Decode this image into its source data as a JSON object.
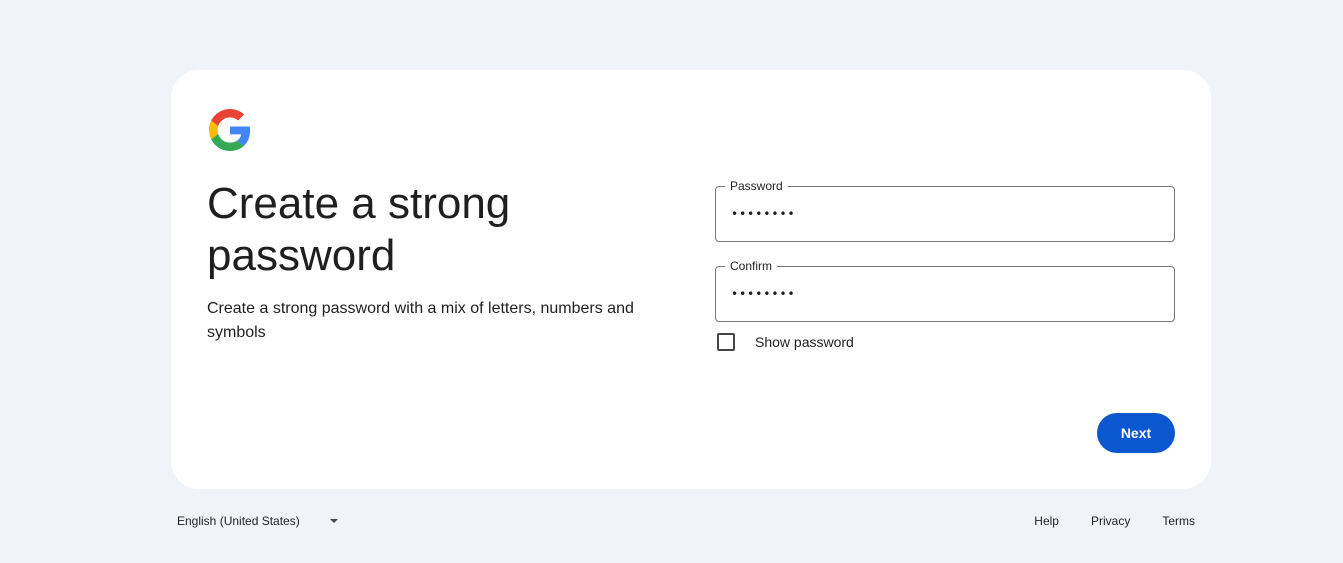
{
  "card": {
    "title": "Create a strong password",
    "subtitle": "Create a strong password with a mix of letters, numbers and symbols"
  },
  "logo": {
    "icon": "google-g-logo-icon",
    "colors": {
      "blue": "#4285F4",
      "red": "#EA4335",
      "yellow": "#FBBC05",
      "green": "#34A853"
    }
  },
  "password_field": {
    "label": "Password",
    "value": "••••••••"
  },
  "confirm_field": {
    "label": "Confirm",
    "value": "••••••••"
  },
  "show_password": {
    "label": "Show password",
    "checked": false
  },
  "next_button": {
    "label": "Next",
    "color": "#0b57d0"
  },
  "footer": {
    "language": "English (United States)",
    "links": [
      "Help",
      "Privacy",
      "Terms"
    ]
  }
}
